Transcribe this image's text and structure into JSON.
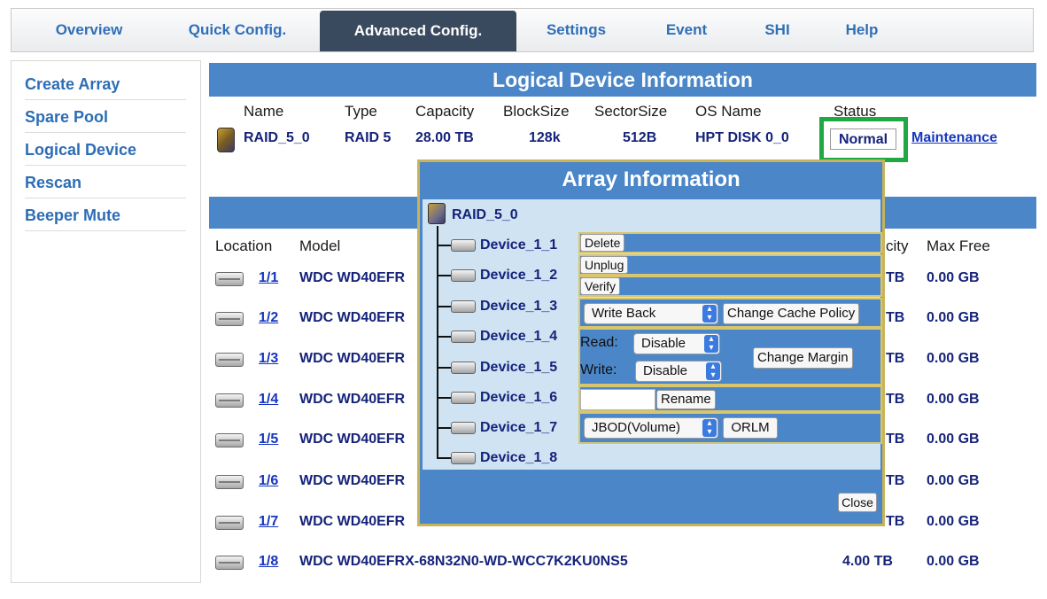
{
  "tabs": [
    {
      "label": "Overview"
    },
    {
      "label": "Quick Config."
    },
    {
      "label": "Advanced Config."
    },
    {
      "label": "Settings"
    },
    {
      "label": "Event"
    },
    {
      "label": "SHI"
    },
    {
      "label": "Help"
    }
  ],
  "active_tab": "Advanced Config.",
  "sidebar": {
    "items": [
      {
        "label": "Create Array"
      },
      {
        "label": "Spare Pool"
      },
      {
        "label": "Logical Device"
      },
      {
        "label": "Rescan"
      },
      {
        "label": "Beeper Mute"
      }
    ]
  },
  "logical_device": {
    "title": "Logical Device Information",
    "headers": {
      "name": "Name",
      "type": "Type",
      "capacity": "Capacity",
      "blocksize": "BlockSize",
      "sectorsize": "SectorSize",
      "osname": "OS Name",
      "status": "Status"
    },
    "row": {
      "name": "RAID_5_0",
      "type": "RAID 5",
      "capacity": "28.00 TB",
      "blocksize": "128k",
      "sectorsize": "512B",
      "osname": "HPT DISK 0_0",
      "status": "Normal",
      "maintenance": "Maintenance"
    }
  },
  "physical_devices": {
    "headers": {
      "location": "Location",
      "model": "Model",
      "capacity_partial": "city",
      "maxfree": "Max Free"
    },
    "rows": [
      {
        "location": "1/1",
        "model": "WDC WD40EFR",
        "capacity": "TB",
        "maxfree": "0.00 GB"
      },
      {
        "location": "1/2",
        "model": "WDC WD40EFR",
        "capacity": "TB",
        "maxfree": "0.00 GB"
      },
      {
        "location": "1/3",
        "model": "WDC WD40EFR",
        "capacity": "TB",
        "maxfree": "0.00 GB"
      },
      {
        "location": "1/4",
        "model": "WDC WD40EFR",
        "capacity": "TB",
        "maxfree": "0.00 GB"
      },
      {
        "location": "1/5",
        "model": "WDC WD40EFR",
        "capacity": "TB",
        "maxfree": "0.00 GB"
      },
      {
        "location": "1/6",
        "model": "WDC WD40EFR",
        "capacity": "TB",
        "maxfree": "0.00 GB"
      },
      {
        "location": "1/7",
        "model": "WDC WD40EFR",
        "capacity": "TB",
        "maxfree": "0.00 GB"
      },
      {
        "location": "1/8",
        "model": "WDC WD40EFRX-68N32N0-WD-WCC7K2KU0NS5",
        "capacity": "4.00 TB",
        "maxfree": "0.00 GB"
      }
    ]
  },
  "modal": {
    "title": "Array Information",
    "array_name": "RAID_5_0",
    "devices": [
      "Device_1_1",
      "Device_1_2",
      "Device_1_3",
      "Device_1_4",
      "Device_1_5",
      "Device_1_6",
      "Device_1_7",
      "Device_1_8"
    ],
    "actions": {
      "delete": "Delete",
      "unplug": "Unplug",
      "verify": "Verify",
      "cache_policy_value": "Write Back",
      "change_cache_policy": "Change Cache Policy",
      "read_label": "Read:",
      "read_value": "Disable",
      "write_label": "Write:",
      "write_value": "Disable",
      "change_margin": "Change Margin",
      "rename": "Rename",
      "rename_value": "",
      "orlm_select_value": "JBOD(Volume)",
      "orlm": "ORLM"
    },
    "close": "Close"
  },
  "colors": {
    "accent_blue": "#4a86c8",
    "active_tab_bg": "#3a4a5e",
    "status_highlight": "#1fa843",
    "modal_border": "#c8b35a",
    "link": "#1536c0"
  }
}
